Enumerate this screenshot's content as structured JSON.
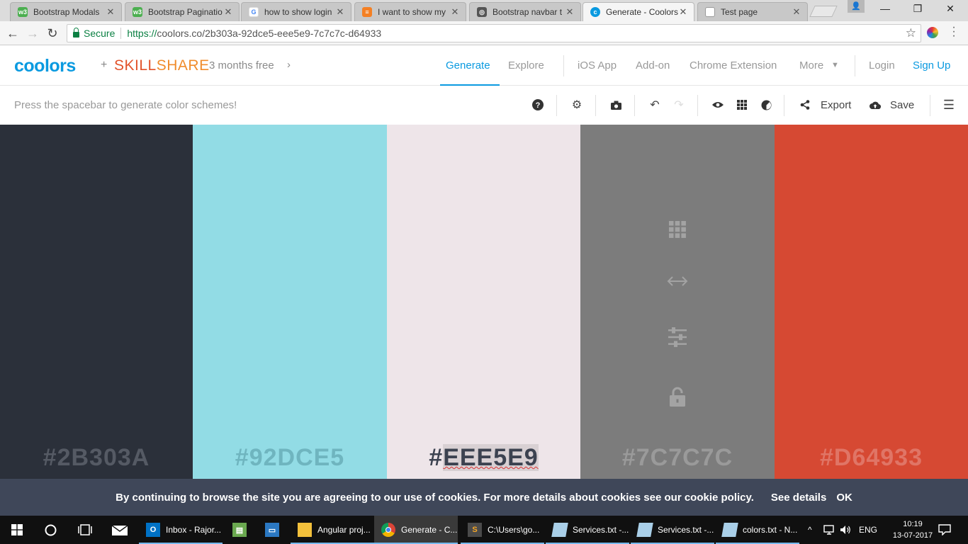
{
  "browser": {
    "tabs": [
      {
        "label": "Bootstrap Modals",
        "icon": "w3schools-icon",
        "color": "#4caf50"
      },
      {
        "label": "Bootstrap Paginatio",
        "icon": "w3schools-icon",
        "color": "#4caf50"
      },
      {
        "label": "how to show login",
        "icon": "google-icon",
        "color": "#4285f4"
      },
      {
        "label": "I want to show my",
        "icon": "stackoverflow-icon",
        "color": "#f48024"
      },
      {
        "label": "Bootstrap navbar t",
        "icon": "bootstrap-icon",
        "color": "#555555"
      },
      {
        "label": "Generate - Coolors",
        "icon": "coolors-icon",
        "color": "#0a9ae0",
        "active": true
      },
      {
        "label": "Test page",
        "icon": "page-icon",
        "color": "#888888"
      }
    ],
    "secure_label": "Secure",
    "url_protocol": "https://",
    "url_rest": "coolors.co/2b303a-92dce5-eee5e9-7c7c7c-d64933"
  },
  "header": {
    "logo": "coolors",
    "plus": "+",
    "partner_part1": "SKILL",
    "partner_part2": "SHARE",
    "promo": "3 months free",
    "nav": {
      "generate": "Generate",
      "explore": "Explore",
      "ios": "iOS App",
      "addon": "Add-on",
      "chrome": "Chrome Extension",
      "more": "More",
      "login": "Login",
      "signup": "Sign Up"
    }
  },
  "toolbar": {
    "hint": "Press the spacebar to generate color schemes!",
    "export": "Export",
    "save": "Save"
  },
  "palette": [
    {
      "hex": "#2B303A",
      "bg": "#2b303a",
      "text_color": "#555a64"
    },
    {
      "hex": "#92DCE5",
      "bg": "#92dce5",
      "text_color": "#6fb5bf"
    },
    {
      "hex_prefix": "#",
      "hex_body": "EEE5E9",
      "bg": "#eee5e9",
      "text_color": "#3c4250",
      "selected": true
    },
    {
      "hex": "#7C7C7C",
      "bg": "#7c7c7c",
      "text_color": "#9a9a9a"
    },
    {
      "hex": "#D64933",
      "bg": "#d64933",
      "text_color": "#e07566"
    }
  ],
  "cookie": {
    "message": "By continuing to browse the site you are agreeing to our use of cookies. For more details about cookies see our cookie policy.",
    "details": "See details",
    "ok": "OK"
  },
  "taskbar": {
    "items": [
      {
        "label": "Inbox - Rajor...",
        "icon": "outlook-icon"
      },
      {
        "label": "Angular proj...",
        "icon": "folder-icon"
      },
      {
        "label": "Generate - C...",
        "icon": "chrome-icon",
        "active": true
      },
      {
        "label": "C:\\Users\\go...",
        "icon": "sublime-icon"
      },
      {
        "label": "Services.txt -...",
        "icon": "notepad-icon"
      },
      {
        "label": "Services.txt -...",
        "icon": "notepad-icon"
      },
      {
        "label": "colors.txt - N...",
        "icon": "notepad-icon"
      }
    ],
    "language": "ENG",
    "time": "10:19",
    "date": "13-07-2017"
  }
}
